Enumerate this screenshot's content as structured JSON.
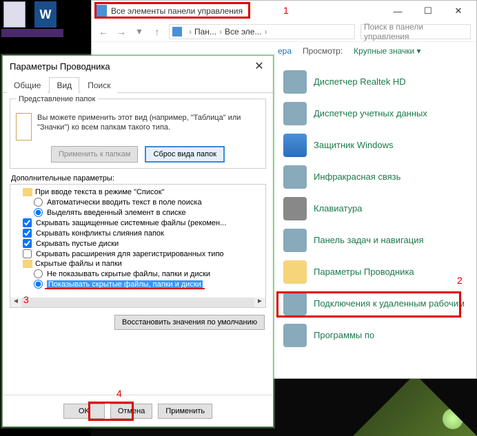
{
  "annotations": {
    "n1": "1",
    "n2": "2",
    "n3": "3",
    "n4": "4"
  },
  "explorer": {
    "title": "Все элементы панели управления",
    "win_min": "—",
    "win_max": "☐",
    "win_close": "✕",
    "nav_back": "←",
    "nav_fwd": "→",
    "nav_up": "↑",
    "crumb1": "Пан...",
    "crumb2": "Все эле...",
    "crumb_sep": "›",
    "search_placeholder": "Поиск в панели управления",
    "header_suffix": "ера",
    "view_label": "Просмотр:",
    "view_value": "Крупные значки ▾",
    "items": [
      "Диспетчер Realtek HD",
      "Диспетчер учетных данных",
      "Защитник Windows",
      "Инфракрасная связь",
      "Клавиатура",
      "Панель задач и навигация",
      "Параметры Проводника",
      "Подключения к удаленным рабочим",
      "Программы по"
    ]
  },
  "dialog": {
    "title": "Параметры Проводника",
    "tabs": {
      "general": "Общие",
      "view": "Вид",
      "search": "Поиск"
    },
    "group_title": "Представление папок",
    "group_text": "Вы можете применить этот вид (например, \"Таблица\" или \"Значки\") ко всем папкам такого типа.",
    "apply_folders": "Применить к папкам",
    "reset_folders": "Сброс вида папок",
    "extra_label": "Дополнительные параметры:",
    "tree": {
      "r0": "При вводе текста в режиме \"Список\"",
      "r1": "Автоматически вводить текст в поле поиска",
      "r2": "Выделять введенный элемент в списке",
      "r3": "Скрывать защищенные системные файлы (рекомен...",
      "r4": "Скрывать конфликты слияния папок",
      "r5": "Скрывать пустые диски",
      "r6": "Скрывать расширения для зарегистрированных типо",
      "r7": "Скрытые файлы и папки",
      "r8": "Не показывать скрытые файлы, папки и диски",
      "r9": "Показывать скрытые файлы, папки и диски"
    },
    "restore": "Восстановить значения по умолчанию",
    "ok": "OK",
    "cancel": "Отмена",
    "apply": "Применить"
  }
}
